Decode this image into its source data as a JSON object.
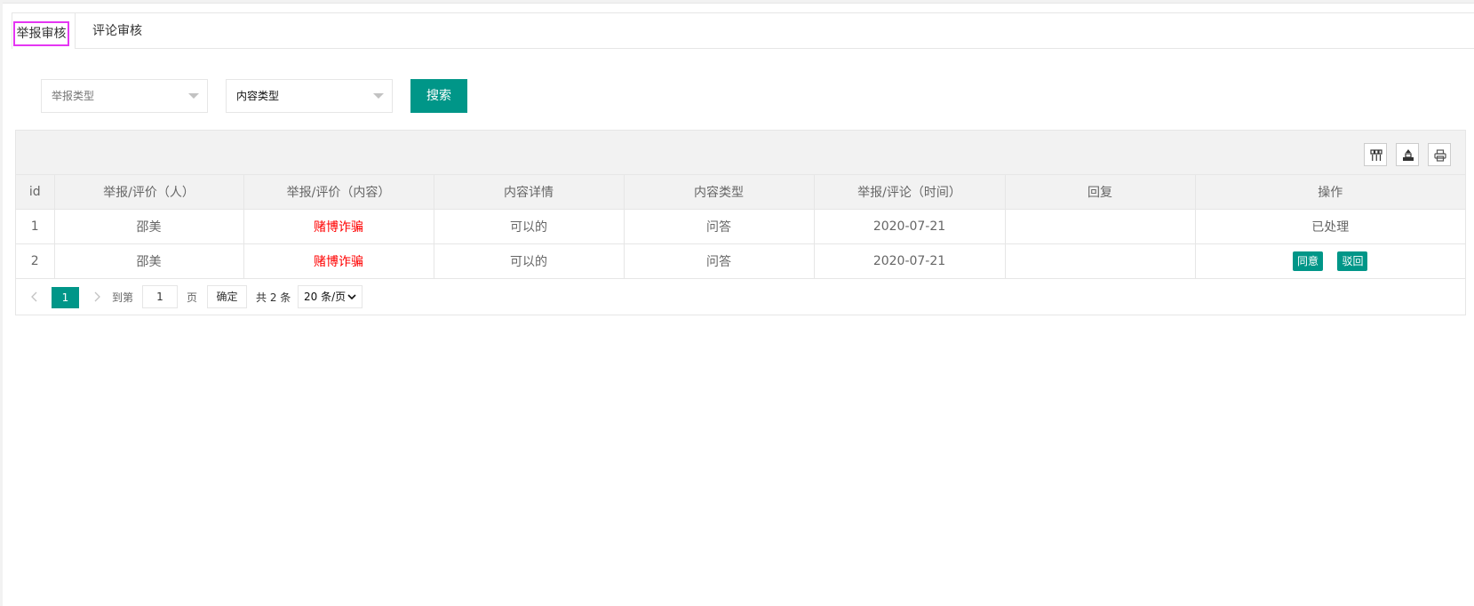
{
  "tabs": [
    {
      "label": "举报审核",
      "active": true
    },
    {
      "label": "评论审核",
      "active": false
    }
  ],
  "filters": {
    "report_type_placeholder": "举报类型",
    "content_type_value": "内容类型",
    "search_label": "搜索"
  },
  "toolbar_icons": [
    "columns-icon",
    "export-icon",
    "print-icon"
  ],
  "table": {
    "headers": [
      "id",
      "举报/评价（人）",
      "举报/评价（内容）",
      "内容详情",
      "内容类型",
      "举报/评论（时间）",
      "回复",
      "操作"
    ],
    "rows": [
      {
        "id": "1",
        "person": "邵美",
        "content": "赌博诈骗",
        "detail": "可以的",
        "type": "问答",
        "time": "2020-07-21",
        "reply": "",
        "status": "已处理"
      },
      {
        "id": "2",
        "person": "邵美",
        "content": "赌博诈骗",
        "detail": "可以的",
        "type": "问答",
        "time": "2020-07-21",
        "reply": "",
        "actions": [
          "同意",
          "驳回"
        ]
      }
    ]
  },
  "pager": {
    "current": "1",
    "goto_label": "到第",
    "goto_value": "1",
    "page_label": "页",
    "confirm_label": "确定",
    "total_label": "共 2 条",
    "page_size": "20 条/页"
  },
  "colors": {
    "accent": "#009688",
    "danger": "#ff0000",
    "tab_highlight": "#e536f3"
  }
}
